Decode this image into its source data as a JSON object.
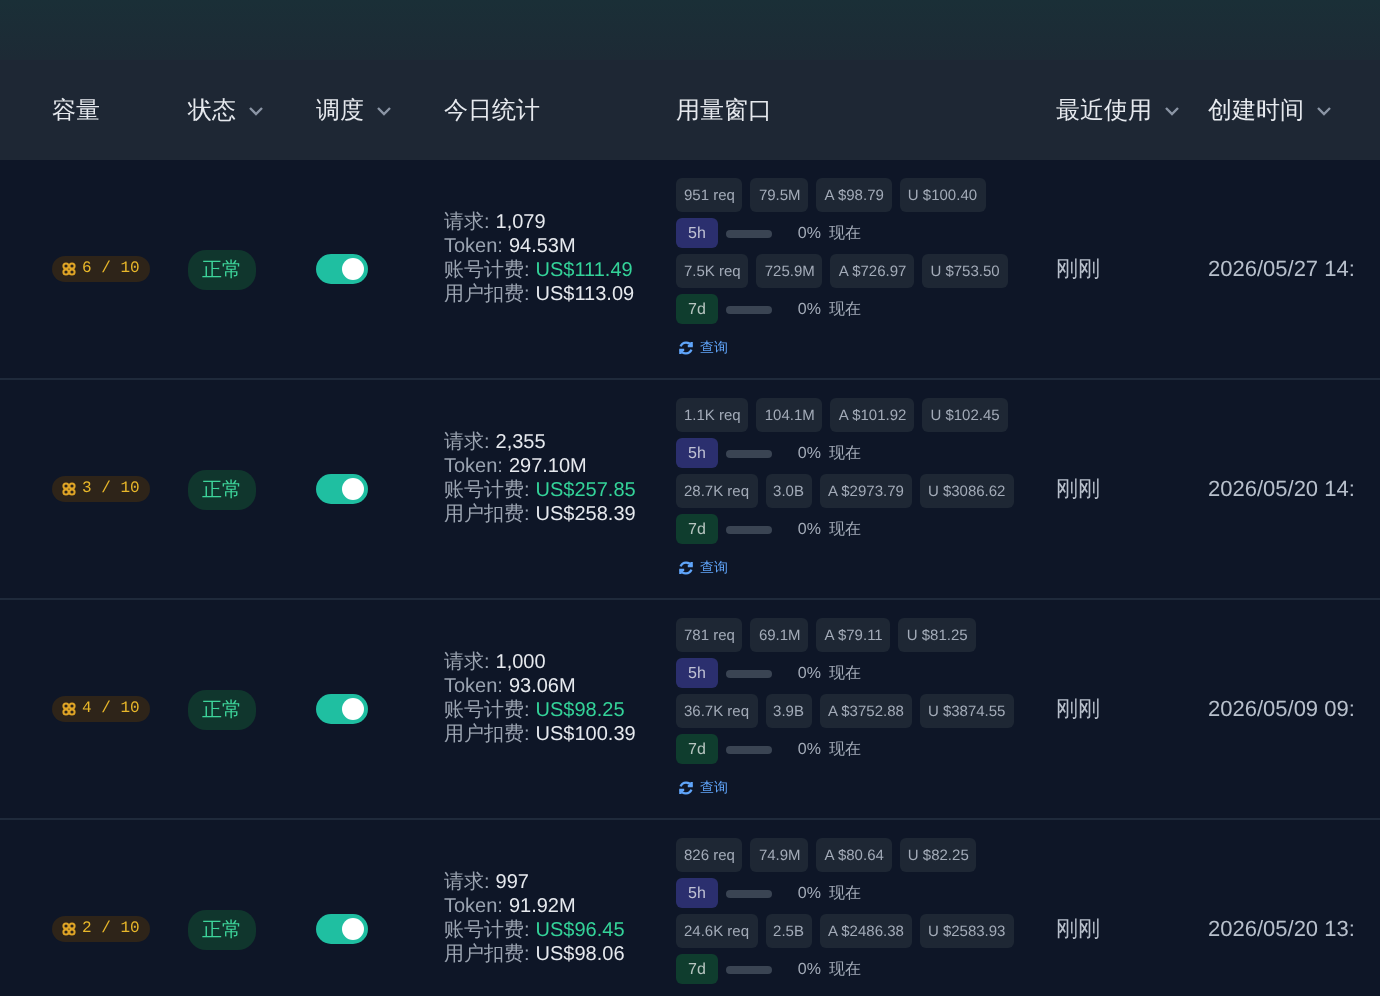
{
  "columns": [
    {
      "label": "容量",
      "sortable": false
    },
    {
      "label": "状态",
      "sortable": true
    },
    {
      "label": "调度",
      "sortable": true
    },
    {
      "label": "今日统计",
      "sortable": false
    },
    {
      "label": "用量窗口",
      "sortable": false
    },
    {
      "label": "最近使用",
      "sortable": true
    },
    {
      "label": "创建时间",
      "sortable": true
    }
  ],
  "rows": [
    {
      "capacity": "6 / 10",
      "status": "正常",
      "scheduling_on": true,
      "stats": [
        {
          "label": "请求:",
          "value": "1,079",
          "highlight": false
        },
        {
          "label": "Token:",
          "value": "94.53M",
          "highlight": false
        },
        {
          "label": "账号计费:",
          "value": "US$111.49",
          "highlight": true
        },
        {
          "label": "用户扣费:",
          "value": "US$113.09",
          "highlight": false
        }
      ],
      "windows": [
        {
          "chips": [
            "951 req",
            "79.5M",
            "A $98.79",
            "U $100.40"
          ],
          "label": "5h",
          "color": "#2b2f6e",
          "level": 0,
          "percent": "0%",
          "reset": "现在"
        },
        {
          "chips": [
            "7.5K req",
            "725.9M",
            "A $726.97",
            "U $753.50"
          ],
          "label": "7d",
          "color": "#0f3d2e",
          "level": 0,
          "percent": "0%",
          "reset": "现在"
        }
      ],
      "query": "查询",
      "last_used": "刚刚",
      "created": "2026/05/27 14:"
    },
    {
      "capacity": "3 / 10",
      "status": "正常",
      "scheduling_on": true,
      "stats": [
        {
          "label": "请求:",
          "value": "2,355",
          "highlight": false
        },
        {
          "label": "Token:",
          "value": "297.10M",
          "highlight": false
        },
        {
          "label": "账号计费:",
          "value": "US$257.85",
          "highlight": true
        },
        {
          "label": "用户扣费:",
          "value": "US$258.39",
          "highlight": false
        }
      ],
      "windows": [
        {
          "chips": [
            "1.1K req",
            "104.1M",
            "A $101.92",
            "U $102.45"
          ],
          "label": "5h",
          "color": "#2b2f6e",
          "level": 0,
          "percent": "0%",
          "reset": "现在"
        },
        {
          "chips": [
            "28.7K req",
            "3.0B",
            "A $2973.79",
            "U $3086.62"
          ],
          "label": "7d",
          "color": "#0f3d2e",
          "level": 0,
          "percent": "0%",
          "reset": "现在"
        }
      ],
      "query": "查询",
      "last_used": "刚刚",
      "created": "2026/05/20 14:"
    },
    {
      "capacity": "4 / 10",
      "status": "正常",
      "scheduling_on": true,
      "stats": [
        {
          "label": "请求:",
          "value": "1,000",
          "highlight": false
        },
        {
          "label": "Token:",
          "value": "93.06M",
          "highlight": false
        },
        {
          "label": "账号计费:",
          "value": "US$98.25",
          "highlight": true
        },
        {
          "label": "用户扣费:",
          "value": "US$100.39",
          "highlight": false
        }
      ],
      "windows": [
        {
          "chips": [
            "781 req",
            "69.1M",
            "A $79.11",
            "U $81.25"
          ],
          "label": "5h",
          "color": "#2b2f6e",
          "level": 0,
          "percent": "0%",
          "reset": "现在"
        },
        {
          "chips": [
            "36.7K req",
            "3.9B",
            "A $3752.88",
            "U $3874.55"
          ],
          "label": "7d",
          "color": "#0f3d2e",
          "level": 0,
          "percent": "0%",
          "reset": "现在"
        }
      ],
      "query": "查询",
      "last_used": "刚刚",
      "created": "2026/05/09 09:"
    },
    {
      "capacity": "2 / 10",
      "status": "正常",
      "scheduling_on": true,
      "stats": [
        {
          "label": "请求:",
          "value": "997",
          "highlight": false
        },
        {
          "label": "Token:",
          "value": "91.92M",
          "highlight": false
        },
        {
          "label": "账号计费:",
          "value": "US$96.45",
          "highlight": true
        },
        {
          "label": "用户扣费:",
          "value": "US$98.06",
          "highlight": false
        }
      ],
      "windows": [
        {
          "chips": [
            "826 req",
            "74.9M",
            "A $80.64",
            "U $82.25"
          ],
          "label": "5h",
          "color": "#2b2f6e",
          "level": 0,
          "percent": "0%",
          "reset": "现在"
        },
        {
          "chips": [
            "24.6K req",
            "2.5B",
            "A $2486.38",
            "U $2583.93"
          ],
          "label": "7d",
          "color": "#0f3d2e",
          "level": 0,
          "percent": "0%",
          "reset": "现在"
        }
      ],
      "last_used": "刚刚",
      "created": "2026/05/20 13:"
    }
  ]
}
